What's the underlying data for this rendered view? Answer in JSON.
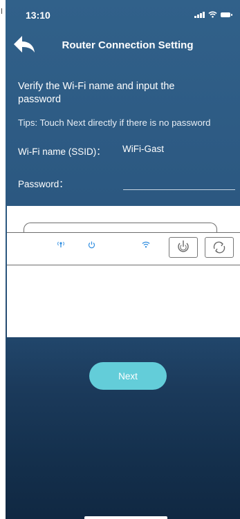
{
  "status_bar": {
    "time": "13:10"
  },
  "header": {
    "back_icon": "back-arrow-icon",
    "title": "Router Connection Setting"
  },
  "form": {
    "heading": "Verify the Wi-Fi name and input the password",
    "tips": "Tips: Touch Next directly if there is no password",
    "ssid_label": "Wi-Fi name (SSID)：",
    "ssid_value": "WiFi-Gast",
    "password_label": "Password：",
    "password_value": ""
  },
  "router_illustration": {
    "indicators": [
      "antenna-icon",
      "power-icon",
      "wifi-icon"
    ],
    "buttons": [
      "power-button-icon",
      "wps-button-icon"
    ]
  },
  "next_label": "Next",
  "colors": {
    "accent_button": "#63cdd9",
    "indicator_blue": "#2f8de0",
    "background_top": "#31618a",
    "background_bottom": "#102842"
  }
}
